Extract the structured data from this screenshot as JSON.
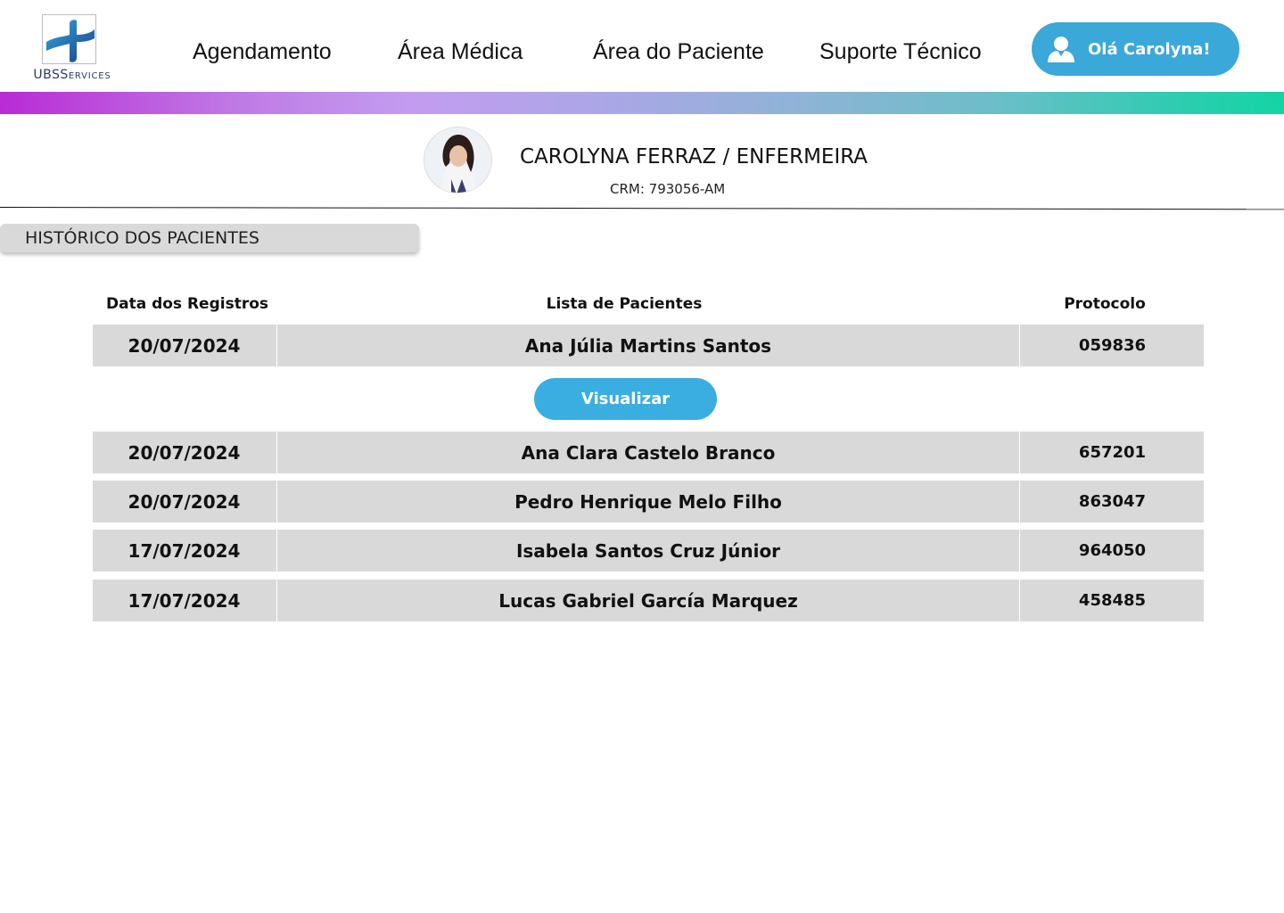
{
  "logo": {
    "brand_main": "UBS",
    "brand_sub": "ERVICES",
    "brand_initial": "S"
  },
  "nav": {
    "items": [
      {
        "label": "Agendamento"
      },
      {
        "label": "Área Médica"
      },
      {
        "label": "Área do Paciente"
      },
      {
        "label": "Suporte Técnico"
      }
    ],
    "greeting": "Olá Carolyna!"
  },
  "profile": {
    "name": "CAROLYNA FERRAZ / ENFERMEIRA",
    "crm": "CRM: 793056-AM"
  },
  "section": {
    "title": "HISTÓRICO DOS PACIENTES"
  },
  "table": {
    "headers": {
      "date": "Data dos Registros",
      "patients": "Lista de Pacientes",
      "protocol": "Protocolo"
    },
    "view_button": "Visualizar",
    "rows": [
      {
        "date": "20/07/2024",
        "name": "Ana Júlia Martins Santos",
        "protocol": "059836"
      },
      {
        "date": "20/07/2024",
        "name": "Ana Clara Castelo Branco",
        "protocol": "657201"
      },
      {
        "date": "20/07/2024",
        "name": "Pedro Henrique Melo Filho",
        "protocol": "863047"
      },
      {
        "date": "17/07/2024",
        "name": "Isabela Santos Cruz Júnior",
        "protocol": "964050"
      },
      {
        "date": "17/07/2024",
        "name": "Lucas Gabriel García Marquez",
        "protocol": "458485"
      }
    ]
  },
  "colors": {
    "accent": "#3aa8d8",
    "row_bg": "#d9d9d9",
    "gradient_start": "#b92bd6",
    "gradient_end": "#14d4a4"
  }
}
